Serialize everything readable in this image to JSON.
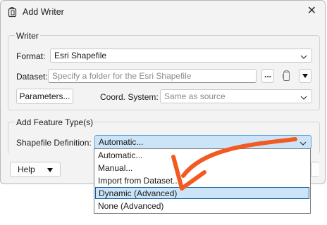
{
  "window": {
    "title": "Add Writer"
  },
  "writer": {
    "legend": "Writer",
    "format_label": "Format:",
    "format_value": "Esri Shapefile",
    "dataset_label": "Dataset:",
    "dataset_placeholder": "Specify a folder for the Esri Shapefile",
    "browse_label": "...",
    "parameters_label": "Parameters...",
    "coord_label": "Coord. System:",
    "coord_value": "Same as source"
  },
  "feature": {
    "legend": "Add Feature Type(s)",
    "shapefile_label": "Shapefile Definition:",
    "shapefile_value": "Automatic...",
    "options": [
      "Automatic...",
      "Manual...",
      "Import from Dataset...",
      "Dynamic (Advanced)",
      "None (Advanced)"
    ],
    "highlighted": "Dynamic (Advanced)"
  },
  "footer": {
    "help_label": "Help"
  },
  "colors": {
    "annotation_arrow": "#f25a22",
    "highlight": "#cce4f7",
    "combo_selected": "#cce4f7"
  }
}
